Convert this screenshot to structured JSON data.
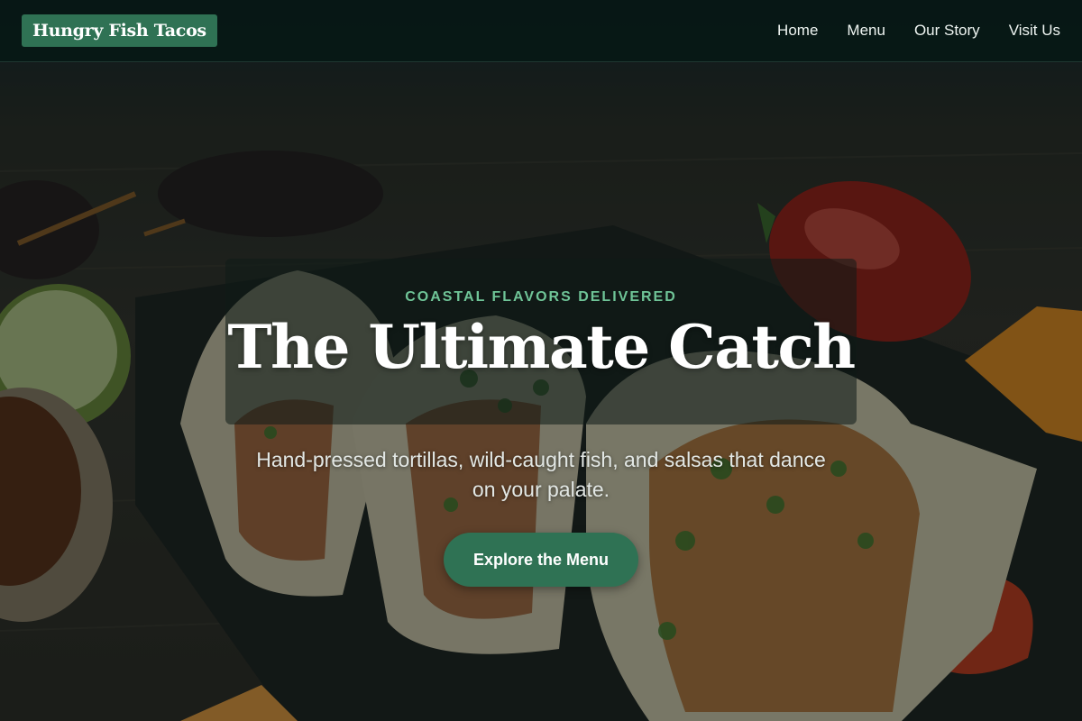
{
  "brand": {
    "name": "Hungry Fish Tacos"
  },
  "nav": {
    "items": [
      {
        "label": "Home"
      },
      {
        "label": "Menu"
      },
      {
        "label": "Our Story"
      },
      {
        "label": "Visit Us"
      }
    ]
  },
  "hero": {
    "eyebrow": "COASTAL FLAVORS DELIVERED",
    "title": "The Ultimate Catch",
    "subtitle": "Hand-pressed tortillas, wild-caught fish, and salsas that dance on your palate.",
    "cta_label": "Explore the Menu"
  },
  "colors": {
    "accent": "#2f7254",
    "eyebrow": "#6fc497",
    "nav_background": "#061814"
  }
}
